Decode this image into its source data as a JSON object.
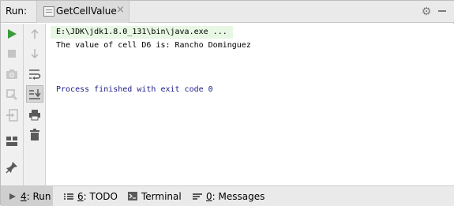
{
  "header": {
    "run_label": "Run:",
    "tab_title": "GetCellValue",
    "tab_close": "×"
  },
  "console": {
    "command": "E:\\JDK\\jdk1.8.0_131\\bin\\java.exe ...",
    "output": "The value of cell D6 is: Rancho Dominguez",
    "exit_message": "Process finished with exit code 0"
  },
  "bottom_tabs": [
    {
      "mnemonic": "4",
      "label": ": Run",
      "icon": "run-triangle-icon"
    },
    {
      "mnemonic": "6",
      "label": ": TODO",
      "icon": "list-icon"
    },
    {
      "mnemonic": "",
      "label": "Terminal",
      "icon": "terminal-icon"
    },
    {
      "mnemonic": "0",
      "label": ": Messages",
      "icon": "messages-icon"
    }
  ],
  "colors": {
    "run_green": "#3c9b3c",
    "command_highlight": "#e7f7e3",
    "exit_text": "#1c1c8c",
    "icon_gray": "#9a9a9a"
  }
}
